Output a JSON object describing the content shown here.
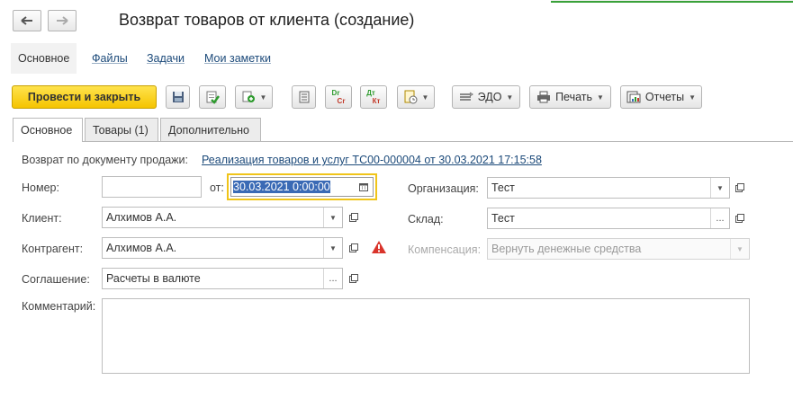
{
  "window": {
    "title": "Возврат товаров от клиента (создание)"
  },
  "sections": [
    {
      "label": "Основное",
      "active": true
    },
    {
      "label": "Файлы",
      "active": false
    },
    {
      "label": "Задачи",
      "active": false
    },
    {
      "label": "Мои заметки",
      "active": false
    }
  ],
  "toolbar": {
    "post_close": "Провести и закрыть",
    "edo": "ЭДО",
    "print": "Печать",
    "reports": "Отчеты",
    "dr_top": "Dr",
    "dr_bottom": "Cr",
    "dt_top": "Дт",
    "dt_bottom": "Кт"
  },
  "tabs": [
    {
      "label": "Основное",
      "active": true
    },
    {
      "label": "Товары (1)",
      "active": false
    },
    {
      "label": "Дополнительно",
      "active": false
    }
  ],
  "form": {
    "basis_label": "Возврат по документу продажи:",
    "basis_link": "Реализация товаров и услуг ТС00-000004 от 30.03.2021 17:15:58",
    "number_label": "Номер:",
    "number_value": "",
    "date_label": "от:",
    "date_value": "30.03.2021  0:00:00",
    "client_label": "Клиент:",
    "client_value": "Алхимов А.А.",
    "counterparty_label": "Контрагент:",
    "counterparty_value": "Алхимов А.А.",
    "agreement_label": "Соглашение:",
    "agreement_value": "Расчеты в валюте",
    "comment_label": "Комментарий:",
    "comment_value": "",
    "org_label": "Организация:",
    "org_value": "Тест",
    "warehouse_label": "Склад:",
    "warehouse_value": "Тест",
    "compensation_label": "Компенсация:",
    "compensation_value": "Вернуть денежные средства"
  },
  "colors": {
    "primary": "#f5c400",
    "link": "#1c4a7a",
    "warning": "#d9342b",
    "focus": "#f0c419",
    "accent_green": "#3aa13a"
  }
}
